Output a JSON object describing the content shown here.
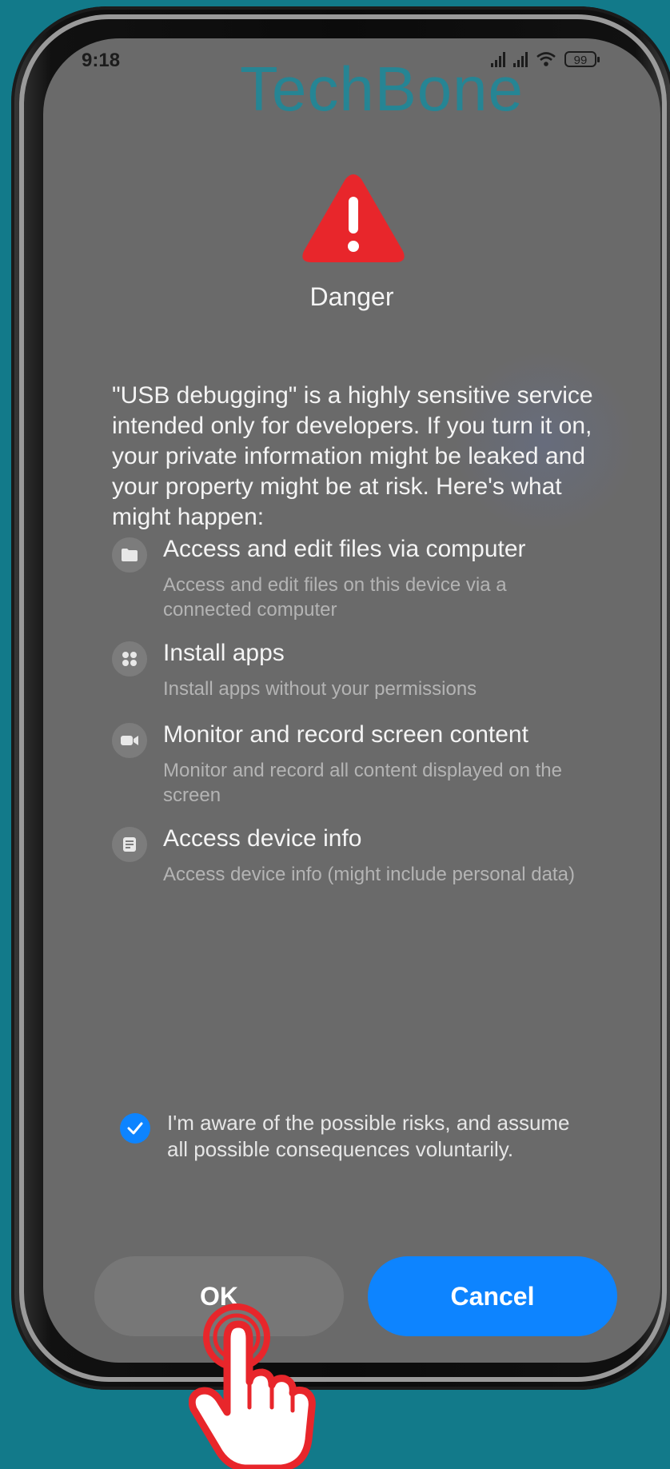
{
  "status_bar": {
    "time": "9:18",
    "battery": "99"
  },
  "watermark": "TechBone",
  "dialog": {
    "title": "Danger",
    "description": "\"USB debugging\" is a highly sensitive service intended only for developers. If you turn it on, your private information might be leaked and your property might be at risk. Here's what might happen:",
    "permissions": [
      {
        "icon": "folder-icon",
        "title": "Access and edit files via computer",
        "subtitle": "Access and edit files on this device via a connected computer"
      },
      {
        "icon": "apps-icon",
        "title": "Install apps",
        "subtitle": "Install apps without your permissions"
      },
      {
        "icon": "camera-icon",
        "title": "Monitor and record screen content",
        "subtitle": "Monitor and record all content displayed on the screen"
      },
      {
        "icon": "device-info-icon",
        "title": "Access device info",
        "subtitle": "Access device info (might include personal data)"
      }
    ],
    "acknowledgement": {
      "checked": true,
      "text": "I'm aware of the possible risks, and assume all possible consequences voluntarily."
    },
    "buttons": {
      "ok": "OK",
      "cancel": "Cancel"
    }
  },
  "colors": {
    "background": "#127a8a",
    "screen": "#6a6a6a",
    "warning": "#e8262b",
    "accent": "#0d84ff",
    "watermark": "#1a8a9c"
  }
}
